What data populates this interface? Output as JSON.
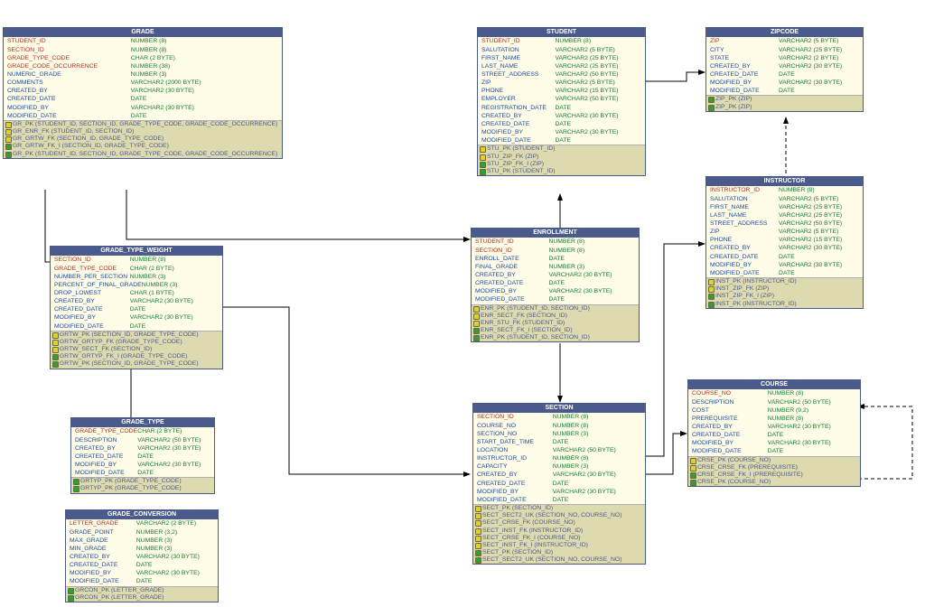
{
  "tables": {
    "grade": {
      "title": "GRADE",
      "cols": [
        {
          "n": "STUDENT_ID",
          "t": "NUMBER (8)",
          "k": "pk"
        },
        {
          "n": "SECTION_ID",
          "t": "NUMBER (8)",
          "k": "pk"
        },
        {
          "n": "GRADE_TYPE_CODE",
          "t": "CHAR (2 BYTE)",
          "k": "pk"
        },
        {
          "n": "GRADE_CODE_OCCURRENCE",
          "t": "NUMBER (38)",
          "k": "pk"
        },
        {
          "n": "NUMERIC_GRADE",
          "t": "NUMBER (3)"
        },
        {
          "n": "COMMENTS",
          "t": "VARCHAR2 (2000 BYTE)"
        },
        {
          "n": "CREATED_BY",
          "t": "VARCHAR2 (30 BYTE)"
        },
        {
          "n": "CREATED_DATE",
          "t": "DATE"
        },
        {
          "n": "MODIFIED_BY",
          "t": "VARCHAR2 (30 BYTE)"
        },
        {
          "n": "MODIFIED_DATE",
          "t": "DATE"
        }
      ],
      "idx": [
        "GR_PK (STUDENT_ID, SECTION_ID, GRADE_TYPE_CODE, GRADE_CODE_OCCURRENCE)",
        "GR_ENR_FK (STUDENT_ID, SECTION_ID)",
        "GR_GRTW_FK (SECTION_ID, GRADE_TYPE_CODE)",
        "GR_GRTW_FK_I (SECTION_ID, GRADE_TYPE_CODE)",
        "GR_PK (STUDENT_ID, SECTION_ID, GRADE_TYPE_CODE, GRADE_CODE_OCCURRENCE)"
      ]
    },
    "student": {
      "title": "STUDENT",
      "cols": [
        {
          "n": "STUDENT_ID",
          "t": "NUMBER (8)",
          "k": "pk"
        },
        {
          "n": "SALUTATION",
          "t": "VARCHAR2 (5 BYTE)"
        },
        {
          "n": "FIRST_NAME",
          "t": "VARCHAR2 (25 BYTE)"
        },
        {
          "n": "LAST_NAME",
          "t": "VARCHAR2 (25 BYTE)"
        },
        {
          "n": "STREET_ADDRESS",
          "t": "VARCHAR2 (50 BYTE)"
        },
        {
          "n": "ZIP",
          "t": "VARCHAR2 (5 BYTE)"
        },
        {
          "n": "PHONE",
          "t": "VARCHAR2 (15 BYTE)"
        },
        {
          "n": "EMPLOYER",
          "t": "VARCHAR2 (50 BYTE)"
        },
        {
          "n": "REGISTRATION_DATE",
          "t": "DATE"
        },
        {
          "n": "CREATED_BY",
          "t": "VARCHAR2 (30 BYTE)"
        },
        {
          "n": "CREATED_DATE",
          "t": "DATE"
        },
        {
          "n": "MODIFIED_BY",
          "t": "VARCHAR2 (30 BYTE)"
        },
        {
          "n": "MODIFIED_DATE",
          "t": "DATE"
        }
      ],
      "idx": [
        "STU_PK (STUDENT_ID)",
        "STU_ZIP_FK (ZIP)",
        "STU_ZIP_FK_I (ZIP)",
        "STU_PK (STUDENT_ID)"
      ]
    },
    "zipcode": {
      "title": "ZIPCODE",
      "cols": [
        {
          "n": "ZIP",
          "t": "VARCHAR2 (5 BYTE)",
          "k": "pk"
        },
        {
          "n": "CITY",
          "t": "VARCHAR2 (25 BYTE)"
        },
        {
          "n": "STATE",
          "t": "VARCHAR2 (2 BYTE)"
        },
        {
          "n": "CREATED_BY",
          "t": "VARCHAR2 (30 BYTE)"
        },
        {
          "n": "CREATED_DATE",
          "t": "DATE"
        },
        {
          "n": "MODIFIED_BY",
          "t": "VARCHAR2 (30 BYTE)"
        },
        {
          "n": "MODIFIED_DATE",
          "t": "DATE"
        }
      ],
      "idx": [
        "ZIP_PK (ZIP)",
        "ZIP_PK (ZIP)"
      ]
    },
    "enrollment": {
      "title": "ENROLLMENT",
      "cols": [
        {
          "n": "STUDENT_ID",
          "t": "NUMBER (8)",
          "k": "pk"
        },
        {
          "n": "SECTION_ID",
          "t": "NUMBER (8)",
          "k": "pk"
        },
        {
          "n": "ENROLL_DATE",
          "t": "DATE"
        },
        {
          "n": "FINAL_GRADE",
          "t": "NUMBER (3)"
        },
        {
          "n": "CREATED_BY",
          "t": "VARCHAR2 (30 BYTE)"
        },
        {
          "n": "CREATED_DATE",
          "t": "DATE"
        },
        {
          "n": "MODIFIED_BY",
          "t": "VARCHAR2 (30 BYTE)"
        },
        {
          "n": "MODIFIED_DATE",
          "t": "DATE"
        }
      ],
      "idx": [
        "ENR_PK (STUDENT_ID, SECTION_ID)",
        "ENR_SECT_FK (SECTION_ID)",
        "ENR_STU_FK (STUDENT_ID)",
        "ENR_SECT_FK_I (SECTION_ID)",
        "ENR_PK (STUDENT_ID, SECTION_ID)"
      ]
    },
    "instructor": {
      "title": "INSTRUCTOR",
      "cols": [
        {
          "n": "INSTRUCTOR_ID",
          "t": "NUMBER (8)",
          "k": "pk"
        },
        {
          "n": "SALUTATION",
          "t": "VARCHAR2 (5 BYTE)"
        },
        {
          "n": "FIRST_NAME",
          "t": "VARCHAR2 (25 BYTE)"
        },
        {
          "n": "LAST_NAME",
          "t": "VARCHAR2 (25 BYTE)"
        },
        {
          "n": "STREET_ADDRESS",
          "t": "VARCHAR2 (50 BYTE)"
        },
        {
          "n": "ZIP",
          "t": "VARCHAR2 (5 BYTE)"
        },
        {
          "n": "PHONE",
          "t": "VARCHAR2 (15 BYTE)"
        },
        {
          "n": "CREATED_BY",
          "t": "VARCHAR2 (30 BYTE)"
        },
        {
          "n": "CREATED_DATE",
          "t": "DATE"
        },
        {
          "n": "MODIFIED_BY",
          "t": "VARCHAR2 (30 BYTE)"
        },
        {
          "n": "MODIFIED_DATE",
          "t": "DATE"
        }
      ],
      "idx": [
        "INST_PK (INSTRUCTOR_ID)",
        "INST_ZIP_FK (ZIP)",
        "INST_ZIP_FK_I (ZIP)",
        "INST_PK (INSTRUCTOR_ID)"
      ]
    },
    "gtw": {
      "title": "GRADE_TYPE_WEIGHT",
      "cols": [
        {
          "n": "SECTION_ID",
          "t": "NUMBER (8)",
          "k": "pk"
        },
        {
          "n": "GRADE_TYPE_CODE",
          "t": "CHAR (2 BYTE)",
          "k": "pk"
        },
        {
          "n": "NUMBER_PER_SECTION",
          "t": "NUMBER (3)"
        },
        {
          "n": "PERCENT_OF_FINAL_GRADE",
          "t": "NUMBER (3)"
        },
        {
          "n": "DROP_LOWEST",
          "t": "CHAR (1 BYTE)"
        },
        {
          "n": "CREATED_BY",
          "t": "VARCHAR2 (30 BYTE)"
        },
        {
          "n": "CREATED_DATE",
          "t": "DATE"
        },
        {
          "n": "MODIFIED_BY",
          "t": "VARCHAR2 (30 BYTE)"
        },
        {
          "n": "MODIFIED_DATE",
          "t": "DATE"
        }
      ],
      "idx": [
        "GRTW_PK (SECTION_ID, GRADE_TYPE_CODE)",
        "GRTW_GRTYP_FK (GRADE_TYPE_CODE)",
        "GRTW_SECT_FK (SECTION_ID)",
        "GRTW_GRTYP_FK_I (GRADE_TYPE_CODE)",
        "GRTW_PK (SECTION_ID, GRADE_TYPE_CODE)"
      ]
    },
    "grade_type": {
      "title": "GRADE_TYPE",
      "cols": [
        {
          "n": "GRADE_TYPE_CODE",
          "t": "CHAR (2 BYTE)",
          "k": "pk"
        },
        {
          "n": "DESCRIPTION",
          "t": "VARCHAR2 (50 BYTE)"
        },
        {
          "n": "CREATED_BY",
          "t": "VARCHAR2 (30 BYTE)"
        },
        {
          "n": "CREATED_DATE",
          "t": "DATE"
        },
        {
          "n": "MODIFIED_BY",
          "t": "VARCHAR2 (30 BYTE)"
        },
        {
          "n": "MODIFIED_DATE",
          "t": "DATE"
        }
      ],
      "idx": [
        "GRTYP_PK (GRADE_TYPE_CODE)",
        "GRTYP_PK (GRADE_TYPE_CODE)"
      ]
    },
    "grade_conversion": {
      "title": "GRADE_CONVERSION",
      "cols": [
        {
          "n": "LETTER_GRADE",
          "t": "VARCHAR2 (2 BYTE)",
          "k": "pk"
        },
        {
          "n": "GRADE_POINT",
          "t": "NUMBER (3,2)"
        },
        {
          "n": "MAX_GRADE",
          "t": "NUMBER (3)"
        },
        {
          "n": "MIN_GRADE",
          "t": "NUMBER (3)"
        },
        {
          "n": "CREATED_BY",
          "t": "VARCHAR2 (30 BYTE)"
        },
        {
          "n": "CREATED_DATE",
          "t": "DATE"
        },
        {
          "n": "MODIFIED_BY",
          "t": "VARCHAR2 (30 BYTE)"
        },
        {
          "n": "MODIFIED_DATE",
          "t": "DATE"
        }
      ],
      "idx": [
        "GRCON_PK (LETTER_GRADE)",
        "GRCON_PK (LETTER_GRADE)"
      ]
    },
    "section": {
      "title": "SECTION",
      "cols": [
        {
          "n": "SECTION_ID",
          "t": "NUMBER (8)",
          "k": "pk"
        },
        {
          "n": "COURSE_NO",
          "t": "NUMBER (8)"
        },
        {
          "n": "SECTION_NO",
          "t": "NUMBER (3)"
        },
        {
          "n": "START_DATE_TIME",
          "t": "DATE"
        },
        {
          "n": "LOCATION",
          "t": "VARCHAR2 (50 BYTE)"
        },
        {
          "n": "INSTRUCTOR_ID",
          "t": "NUMBER (8)"
        },
        {
          "n": "CAPACITY",
          "t": "NUMBER (3)"
        },
        {
          "n": "CREATED_BY",
          "t": "VARCHAR2 (30 BYTE)"
        },
        {
          "n": "CREATED_DATE",
          "t": "DATE"
        },
        {
          "n": "MODIFIED_BY",
          "t": "VARCHAR2 (30 BYTE)"
        },
        {
          "n": "MODIFIED_DATE",
          "t": "DATE"
        }
      ],
      "idx": [
        "SECT_PK (SECTION_ID)",
        "SECT_SECT2_UK (SECTION_NO, COURSE_NO)",
        "SECT_CRSE_FK (COURSE_NO)",
        "SECT_INST_FK (INSTRUCTOR_ID)",
        "SECT_CRSE_FK_I (COURSE_NO)",
        "SECT_INST_FK_I (INSTRUCTOR_ID)",
        "SECT_PK (SECTION_ID)",
        "SECT_SECT2_UK (SECTION_NO, COURSE_NO)"
      ]
    },
    "course": {
      "title": "COURSE",
      "cols": [
        {
          "n": "COURSE_NO",
          "t": "NUMBER (8)",
          "k": "pk"
        },
        {
          "n": "DESCRIPTION",
          "t": "VARCHAR2 (50 BYTE)"
        },
        {
          "n": "COST",
          "t": "NUMBER (9,2)"
        },
        {
          "n": "PREREQUISITE",
          "t": "NUMBER (8)"
        },
        {
          "n": "CREATED_BY",
          "t": "VARCHAR2 (30 BYTE)"
        },
        {
          "n": "CREATED_DATE",
          "t": "DATE"
        },
        {
          "n": "MODIFIED_BY",
          "t": "VARCHAR2 (30 BYTE)"
        },
        {
          "n": "MODIFIED_DATE",
          "t": "DATE"
        }
      ],
      "idx": [
        "CRSE_PK (COURSE_NO)",
        "CRSE_CRSE_FK (PREREQUISITE)",
        "CRSE_CRSE_FK_I (PREREQUISITE)",
        "CRSE_PK (COURSE_NO)"
      ]
    }
  }
}
